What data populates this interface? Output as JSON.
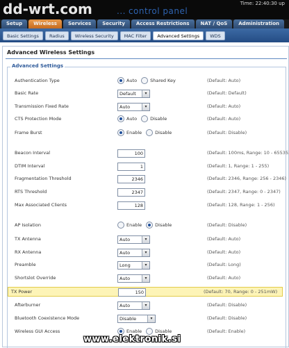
{
  "header": {
    "logo": "dd-wrt.com",
    "subtitle": "control panel",
    "subtitle_dots": "...",
    "time": "Time: 22:40:30 up"
  },
  "main_tabs": [
    {
      "label": "Setup",
      "active": false
    },
    {
      "label": "Wireless",
      "active": true
    },
    {
      "label": "Services",
      "active": false
    },
    {
      "label": "Security",
      "active": false
    },
    {
      "label": "Access Restrictions",
      "active": false
    },
    {
      "label": "NAT / QoS",
      "active": false
    },
    {
      "label": "Administration",
      "active": false
    }
  ],
  "sub_tabs": [
    {
      "label": "Basic Settings",
      "active": false
    },
    {
      "label": "Radius",
      "active": false
    },
    {
      "label": "Wireless Security",
      "active": false
    },
    {
      "label": "MAC Filter",
      "active": false
    },
    {
      "label": "Advanced Settings",
      "active": true
    },
    {
      "label": "WDS",
      "active": false
    }
  ],
  "page": {
    "title": "Advanced Wireless Settings",
    "legend": "Advanced Settings"
  },
  "settings": [
    {
      "label": "Authentication Type",
      "type": "radio",
      "options": [
        "Auto",
        "Shared Key"
      ],
      "selected": "Auto",
      "default": "(Default: Auto)"
    },
    {
      "label": "Basic Rate",
      "type": "select",
      "value": "Default",
      "default": "(Default: Default)"
    },
    {
      "label": "Transmission Fixed Rate",
      "type": "select",
      "value": "Auto",
      "default": "(Default: Auto)"
    },
    {
      "label": "CTS Protection Mode",
      "type": "radio",
      "options": [
        "Auto",
        "Disable"
      ],
      "selected": "Auto",
      "default": "(Default: Auto)"
    },
    {
      "label": "Frame Burst",
      "type": "radio",
      "options": [
        "Enable",
        "Disable"
      ],
      "selected": "Enable",
      "default": "(Default: Disable)"
    },
    {
      "label": "Beacon Interval",
      "type": "text",
      "value": "100",
      "default": "(Default: 100ms, Range: 10 - 65535)"
    },
    {
      "label": "DTIM Interval",
      "type": "text",
      "value": "1",
      "default": "(Default: 1, Range: 1 - 255)"
    },
    {
      "label": "Fragmentation Threshold",
      "type": "text",
      "value": "2346",
      "default": "(Default: 2346, Range: 256 - 2346)"
    },
    {
      "label": "RTS Threshold",
      "type": "text",
      "value": "2347",
      "default": "(Default: 2347, Range: 0 - 2347)"
    },
    {
      "label": "Max Associated Clients",
      "type": "text",
      "value": "128",
      "default": "(Default: 128, Range: 1 - 256)"
    },
    {
      "label": "AP Isolation",
      "type": "radio",
      "options": [
        "Enable",
        "Disable"
      ],
      "selected": "Disable",
      "default": "(Default: Disable)"
    },
    {
      "label": "TX Antenna",
      "type": "select",
      "value": "Auto",
      "default": "(Default: Auto)"
    },
    {
      "label": "RX Antenna",
      "type": "select",
      "value": "Auto",
      "default": "(Default: Auto)"
    },
    {
      "label": "Preamble",
      "type": "select",
      "value": "Long",
      "default": "(Default: Long)"
    },
    {
      "label": "Shortslot Override",
      "type": "select",
      "value": "Auto",
      "default": "(Default: Auto)"
    },
    {
      "label": "TX Power",
      "type": "text",
      "value": "150",
      "default": "(Default: 70, Range: 0 - 251mW)",
      "highlight": true
    },
    {
      "label": "Afterburner",
      "type": "select",
      "value": "Auto",
      "default": "(Default: Disable)"
    },
    {
      "label": "Bluetooth Coexistence Mode",
      "type": "select",
      "value": "Disable",
      "default": "(Default: Disable)"
    },
    {
      "label": "Wireless GUI Access",
      "type": "radio",
      "options": [
        "Enable",
        "Disable"
      ],
      "selected": "Enable",
      "default": "(Default: Enable)"
    }
  ],
  "watermark": "www.elektronik.si",
  "icons": {
    "select_arrow": "chevron-down-icon",
    "radio": "radio-icon"
  }
}
